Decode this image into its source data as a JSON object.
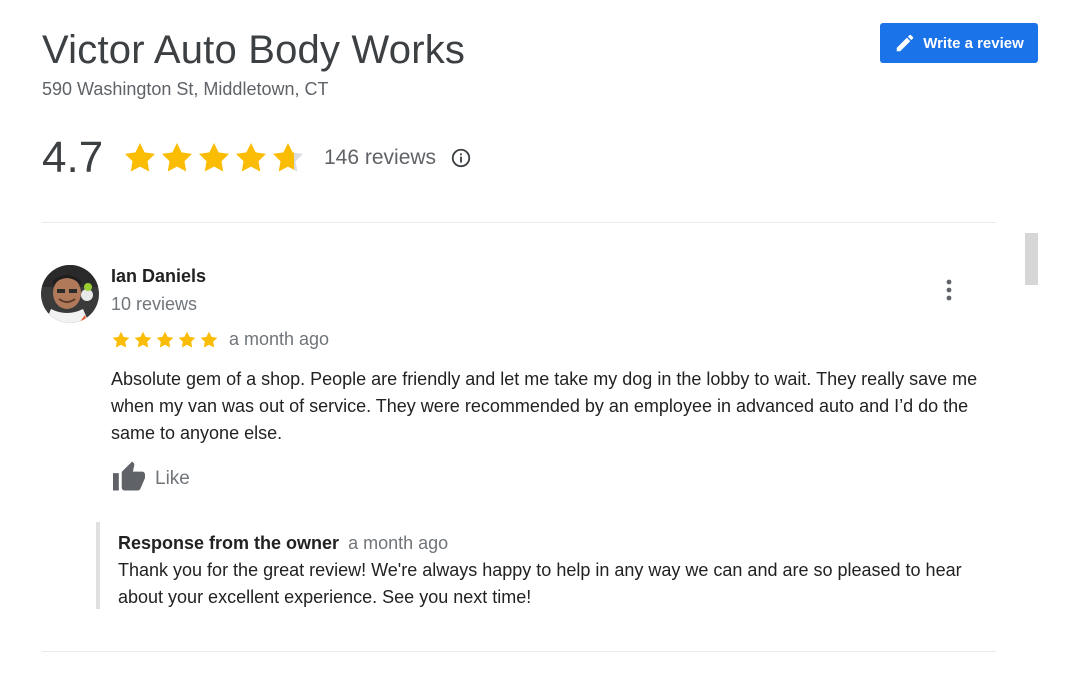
{
  "business": {
    "name": "Victor Auto Body Works",
    "address": "590 Washington St, Middletown, CT"
  },
  "write_review": {
    "label": "Write a review",
    "icon": "pencil-icon",
    "color": "#1a73e8"
  },
  "rating": {
    "value": "4.7",
    "stars": 4.7,
    "max_stars": 5,
    "reviews_label": "146 reviews",
    "info_icon": "info-icon",
    "star_color": "#fbbc04"
  },
  "review": {
    "author": "Ian Daniels",
    "author_reviews": "10 reviews",
    "stars": 5,
    "time": "a month ago",
    "text": "Absolute gem of a shop. People are friendly and let me take my dog in the lobby to wait. They really save me when my van was out of service. They were recommended by an employee in advanced auto and I’d do the same to anyone else.",
    "like_label": "Like",
    "menu_icon": "more-vert-icon",
    "response": {
      "label": "Response from the owner",
      "time": "a month ago",
      "text": "Thank you for the great review! We're always happy to help in any way we can and are so pleased to hear about your excellent experience. See you next time!"
    }
  }
}
